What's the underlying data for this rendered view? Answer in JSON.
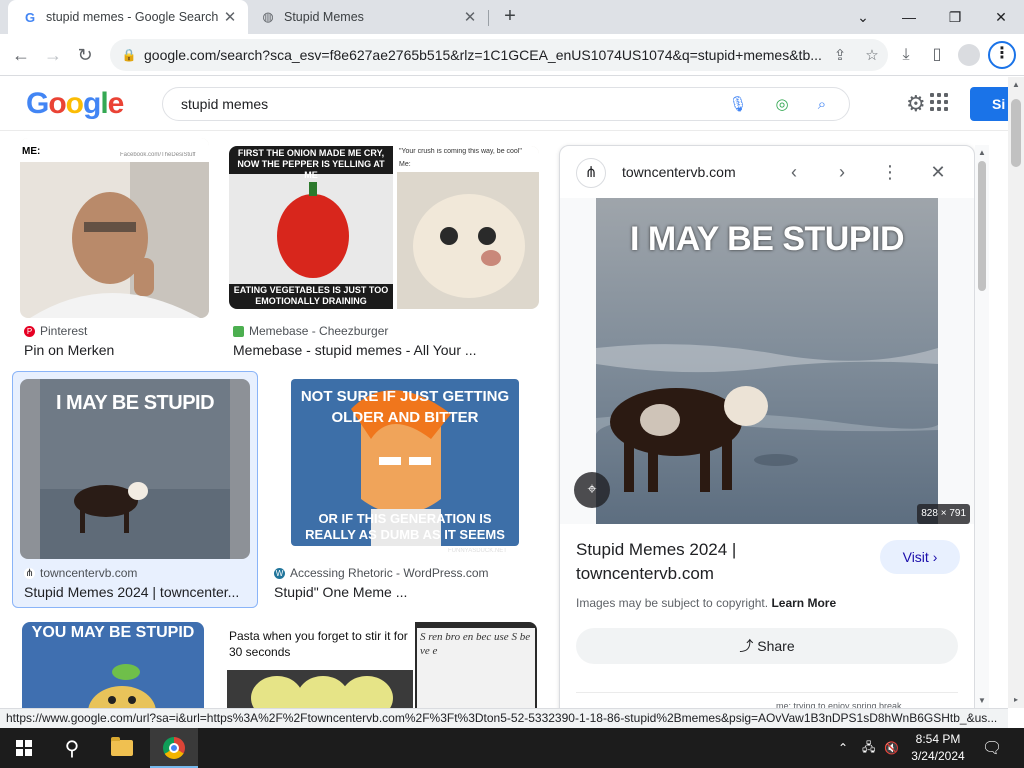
{
  "browser": {
    "tabs": [
      {
        "label": "stupid memes - Google Search",
        "favicon": "google-g-icon",
        "active": true
      },
      {
        "label": "Stupid Memes",
        "favicon": "globe-icon",
        "active": false
      }
    ],
    "url": "google.com/search?sca_esv=f8e627ae2765b515&rlz=1C1GCEA_enUS1074US1074&q=stupid+memes&tb..."
  },
  "google": {
    "logo": [
      "G",
      "o",
      "o",
      "g",
      "l",
      "e"
    ],
    "logo_colors": [
      "#4285f4",
      "#ea4335",
      "#fbbc05",
      "#4285f4",
      "#34a853",
      "#ea4335"
    ],
    "query": "stupid memes",
    "signin_label": "Si"
  },
  "results": [
    {
      "source": "Pinterest",
      "title": "Pin on Merken",
      "favicon_color": "#e60023",
      "meme_top": "ME:",
      "meme_watermark": "Facebook.com/TheDesiStuff"
    },
    {
      "source": "Memebase - Cheezburger",
      "title": "Memebase - stupid memes - All Your ...",
      "favicon_color": "#4caf50",
      "meme_top": "FIRST THE ONION MADE ME CRY, NOW THE PEPPER IS YELLING AT ME",
      "meme_bottom": "EATING VEGETABLES IS JUST TOO EMOTIONALLY DRAINING",
      "meme_side": "\"Your crush is coming this way, be cool\"",
      "meme_side2": "Me:"
    },
    {
      "source": "towncentervb.com",
      "title": "Stupid Memes 2024 | towncenter...",
      "favicon_color": "#202124",
      "meme_top": "I MAY BE STUPID"
    },
    {
      "source": "Accessing Rhetoric - WordPress.com",
      "title": "Stupid\" One Meme ...",
      "favicon_color": "#21759b",
      "meme_top": "NOT SURE IF JUST GETTING OLDER AND BITTER",
      "meme_bottom": "OR IF THIS GENERATION IS REALLY AS DUMB AS IT SEEMS",
      "meme_watermark": "FUNNYASDUCK.NET"
    },
    {
      "meme_top": "YOU MAY BE STUPID"
    },
    {
      "meme_top": "Pasta when you forget to stir it for 30 seconds",
      "meme_side": "S  ren bro  en bec  use S  be  ve  e"
    }
  ],
  "preview": {
    "site": "towncentervb.com",
    "meme_text": "I MAY BE STUPID",
    "dimensions": "828 × 791",
    "title": "Stupid Memes 2024 | towncentervb.com",
    "visit_label": "Visit",
    "copyright_text": "Images may be subject to copyright.",
    "learn_more": "Learn More",
    "share_label": "Share",
    "related_caption": "me: trying to enjoy spring break"
  },
  "status_url": "https://www.google.com/url?sa=i&url=https%3A%2F%2Ftowncentervb.com%2F%3Ft%3Dton5-52-5332390-1-18-86-stupid%2Bmemes&psig=AOvVaw1B3nDPS1sD8hWnB6GSHtb_&us...",
  "taskbar": {
    "time": "8:54 PM",
    "date": "3/24/2024"
  }
}
